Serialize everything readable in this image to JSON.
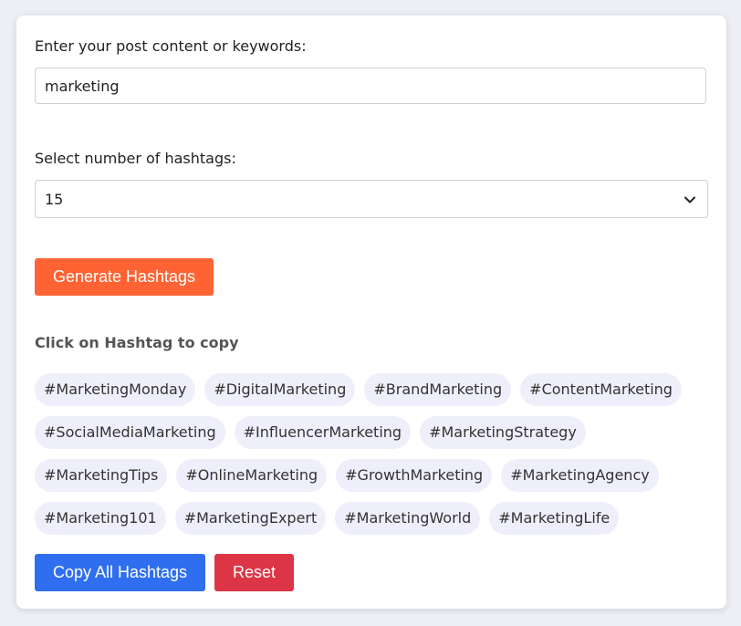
{
  "form": {
    "content_label": "Enter your post content or keywords:",
    "content_value": "marketing",
    "count_label": "Select number of hashtags:",
    "count_value": "15"
  },
  "buttons": {
    "generate": "Generate Hashtags",
    "copy_all": "Copy All Hashtags",
    "reset": "Reset"
  },
  "results": {
    "title": "Click on Hashtag to copy",
    "hashtags": [
      "#MarketingMonday",
      "#DigitalMarketing",
      "#BrandMarketing",
      "#ContentMarketing",
      "#SocialMediaMarketing",
      "#InfluencerMarketing",
      "#MarketingStrategy",
      "#MarketingTips",
      "#OnlineMarketing",
      "#GrowthMarketing",
      "#MarketingAgency",
      "#Marketing101",
      "#MarketingExpert",
      "#MarketingWorld",
      "#MarketingLife"
    ]
  },
  "colors": {
    "generate_button": "#ff6333",
    "copy_button": "#2f6fef",
    "reset_button": "#dc3545",
    "tag_background": "#efeffc"
  },
  "icons": {
    "select_arrow": "chevron-down-icon"
  }
}
